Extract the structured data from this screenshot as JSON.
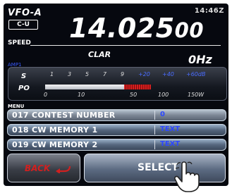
{
  "header": {
    "vfo": "VFO-A",
    "mode_badge": "C-U",
    "time": "14:46Z",
    "frequency_main": "14.025",
    "frequency_small": "00",
    "speed_label": "SPEED"
  },
  "clar": {
    "label": "CLAR",
    "value": "0Hz"
  },
  "amp_label": "AMP1",
  "meter": {
    "s_label": "S",
    "po_label": "PO",
    "s_scale": [
      "1",
      "3",
      "5",
      "7",
      "9"
    ],
    "s_scale_over": [
      "+20",
      "+40",
      "+60dB"
    ],
    "po_scale": [
      "0",
      "10",
      "50",
      "100",
      "150W"
    ]
  },
  "menu": {
    "label": "MENU",
    "rows": [
      {
        "text": "017  CONTEST NUMBER",
        "value": "0"
      },
      {
        "text": "018  CW MEMORY 1",
        "value": "TEXT"
      },
      {
        "text": "019  CW MEMORY 2",
        "value": "TEXT"
      }
    ]
  },
  "buttons": {
    "back": "BACK",
    "select": "SELECT"
  },
  "colors": {
    "background": "#06080f",
    "accent_blue": "#2d48ff",
    "back_red": "#d02020"
  }
}
